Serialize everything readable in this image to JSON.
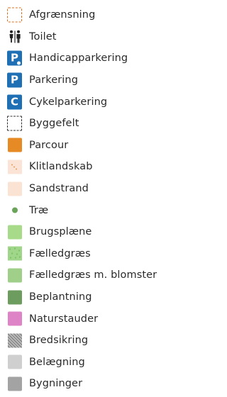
{
  "legend": {
    "items": [
      {
        "label": "Afgrænsning",
        "symbol": "boundary-dashed-orange",
        "color": "#d86f1e"
      },
      {
        "label": "Toilet",
        "symbol": "toilet-icon",
        "color": "#222222"
      },
      {
        "label": "Handicapparkering",
        "symbol": "handicap-parking-icon",
        "color": "#1f6fb5",
        "letter": "P"
      },
      {
        "label": "Parkering",
        "symbol": "parking-icon",
        "color": "#1f6fb5",
        "letter": "P"
      },
      {
        "label": "Cykelparkering",
        "symbol": "bicycle-parking-icon",
        "color": "#1f6fb5",
        "letter": "C"
      },
      {
        "label": "Byggefelt",
        "symbol": "building-plot-dashed",
        "color": "#333333"
      },
      {
        "label": "Parcour",
        "symbol": "swatch",
        "color": "#e58a24"
      },
      {
        "label": "Klitlandskab",
        "symbol": "dunes-swatch",
        "color": "#fbe4d5"
      },
      {
        "label": "Sandstrand",
        "symbol": "swatch",
        "color": "#fbe3d3"
      },
      {
        "label": "Træ",
        "symbol": "tree-dot",
        "color": "#6aa35a"
      },
      {
        "label": "Brugsplæne",
        "symbol": "swatch",
        "color": "#a7db8a"
      },
      {
        "label": "Fælledgræs",
        "symbol": "meadow-swatch",
        "color": "#9fd68a"
      },
      {
        "label": "Fælledgræs m. blomster",
        "symbol": "swatch",
        "color": "#9fcf88"
      },
      {
        "label": "Beplantning",
        "symbol": "swatch",
        "color": "#6d9c5f"
      },
      {
        "label": "Naturstauder",
        "symbol": "swatch",
        "color": "#de83c6"
      },
      {
        "label": "Bredsikring",
        "symbol": "hatched-swatch",
        "color": "#8f8f8f"
      },
      {
        "label": "Belægning",
        "symbol": "swatch",
        "color": "#cfcfcf"
      },
      {
        "label": "Bygninger",
        "symbol": "swatch",
        "color": "#a3a3a3"
      }
    ]
  }
}
